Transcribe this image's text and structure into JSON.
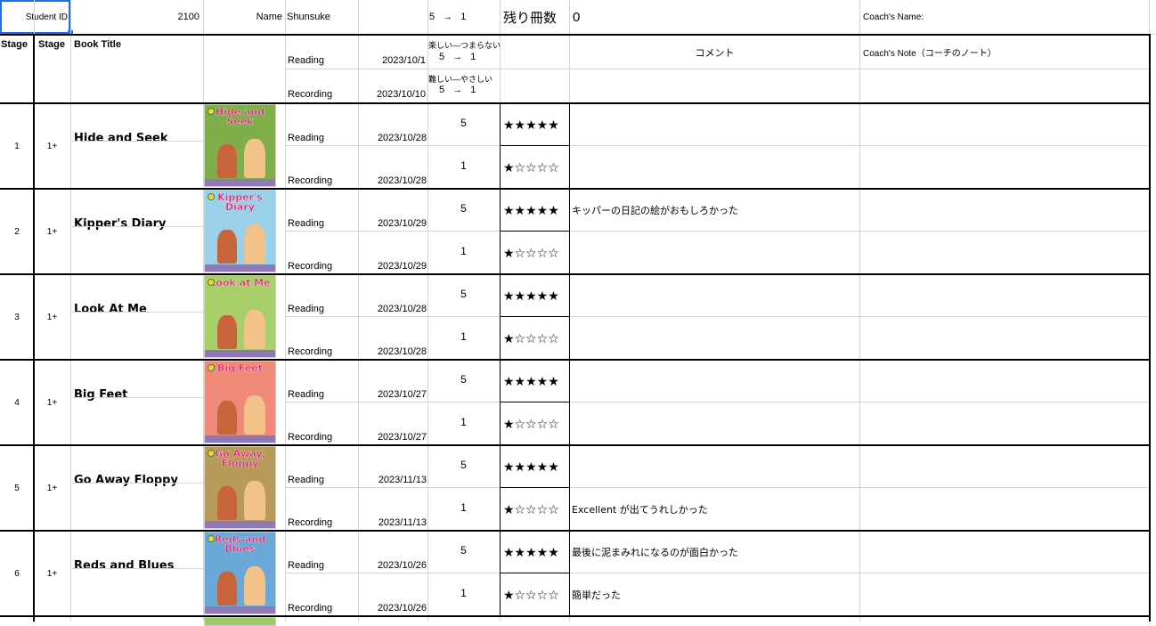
{
  "header": {
    "student_id_label": "Student ID",
    "student_id": "2100",
    "name_label": "Name",
    "name": "Shunsuke",
    "scale": "5 → 1",
    "remaining_label": "残り冊数",
    "remaining": "0",
    "coach_name_label": "Coach's Name:"
  },
  "columns": {
    "stage1": "Stage",
    "stage2": "Stage",
    "book_title": "Book Title",
    "comment": "コメント",
    "coach_note": "Coach's Note（コーチのノート）"
  },
  "legend": {
    "reading_label": "Reading",
    "reading_date": "2023/10/1",
    "recording_label": "Recording",
    "recording_date": "2023/10/10",
    "fun_caption": "楽しい—つまらない",
    "fun_scale": "5 → 1",
    "difficulty_caption": "難しい—やさしい",
    "difficulty_scale": "5 → 1"
  },
  "books": [
    {
      "num": "1",
      "stage": "1+",
      "title": "Hide and Seek",
      "cover_title": "Hide and Seek",
      "cover_color": "#7fae4a",
      "reading_date": "2023/10/28",
      "recording_date": "2023/10/28",
      "fun": "5",
      "difficulty": "1",
      "fun_stars": "★★★★★",
      "diff_stars": "★☆☆☆☆",
      "comment_reading": "",
      "comment_recording": ""
    },
    {
      "num": "2",
      "stage": "1+",
      "title": "Kipper's Diary",
      "cover_title": "Kipper's Diary",
      "cover_color": "#9ad0e8",
      "reading_date": "2023/10/29",
      "recording_date": "2023/10/29",
      "fun": "5",
      "difficulty": "1",
      "fun_stars": "★★★★★",
      "diff_stars": "★☆☆☆☆",
      "comment_reading": "キッパーの日記の絵がおもしろかった",
      "comment_recording": ""
    },
    {
      "num": "3",
      "stage": "1+",
      "title": "Look At Me",
      "cover_title": "Look at Me",
      "cover_color": "#a8cf6a",
      "reading_date": "2023/10/28",
      "recording_date": "2023/10/28",
      "fun": "5",
      "difficulty": "1",
      "fun_stars": "★★★★★",
      "diff_stars": "★☆☆☆☆",
      "comment_reading": "",
      "comment_recording": ""
    },
    {
      "num": "4",
      "stage": "1+",
      "title": "Big Feet",
      "cover_title": "Big Feet",
      "cover_color": "#f08a78",
      "reading_date": "2023/10/27",
      "recording_date": "2023/10/27",
      "fun": "5",
      "difficulty": "1",
      "fun_stars": "★★★★★",
      "diff_stars": "★☆☆☆☆",
      "comment_reading": "",
      "comment_recording": ""
    },
    {
      "num": "5",
      "stage": "1+",
      "title": "Go Away Floppy",
      "cover_title": "Go Away, Floppy",
      "cover_color": "#b89a5a",
      "reading_date": "2023/11/13",
      "recording_date": "2023/11/13",
      "fun": "5",
      "difficulty": "1",
      "fun_stars": "★★★★★",
      "diff_stars": "★☆☆☆☆",
      "comment_reading": "",
      "comment_recording": "Excellent が出てうれしかった"
    },
    {
      "num": "6",
      "stage": "1+",
      "title": "Reds and Blues",
      "cover_title": "Reds and Blues",
      "cover_color": "#6aa8d8",
      "reading_date": "2023/10/26",
      "recording_date": "2023/10/26",
      "fun": "5",
      "difficulty": "1",
      "fun_stars": "★★★★★",
      "diff_stars": "★☆☆☆☆",
      "comment_reading": "最後に泥まみれになるのが面白かった",
      "comment_recording": "簡単だった"
    }
  ],
  "row_labels": {
    "reading": "Reading",
    "recording": "Recording"
  },
  "colors": {
    "grid": "#d6d6d6",
    "border": "#000000",
    "cover_band": "#8e79b6",
    "selection": "#1a73e8"
  }
}
